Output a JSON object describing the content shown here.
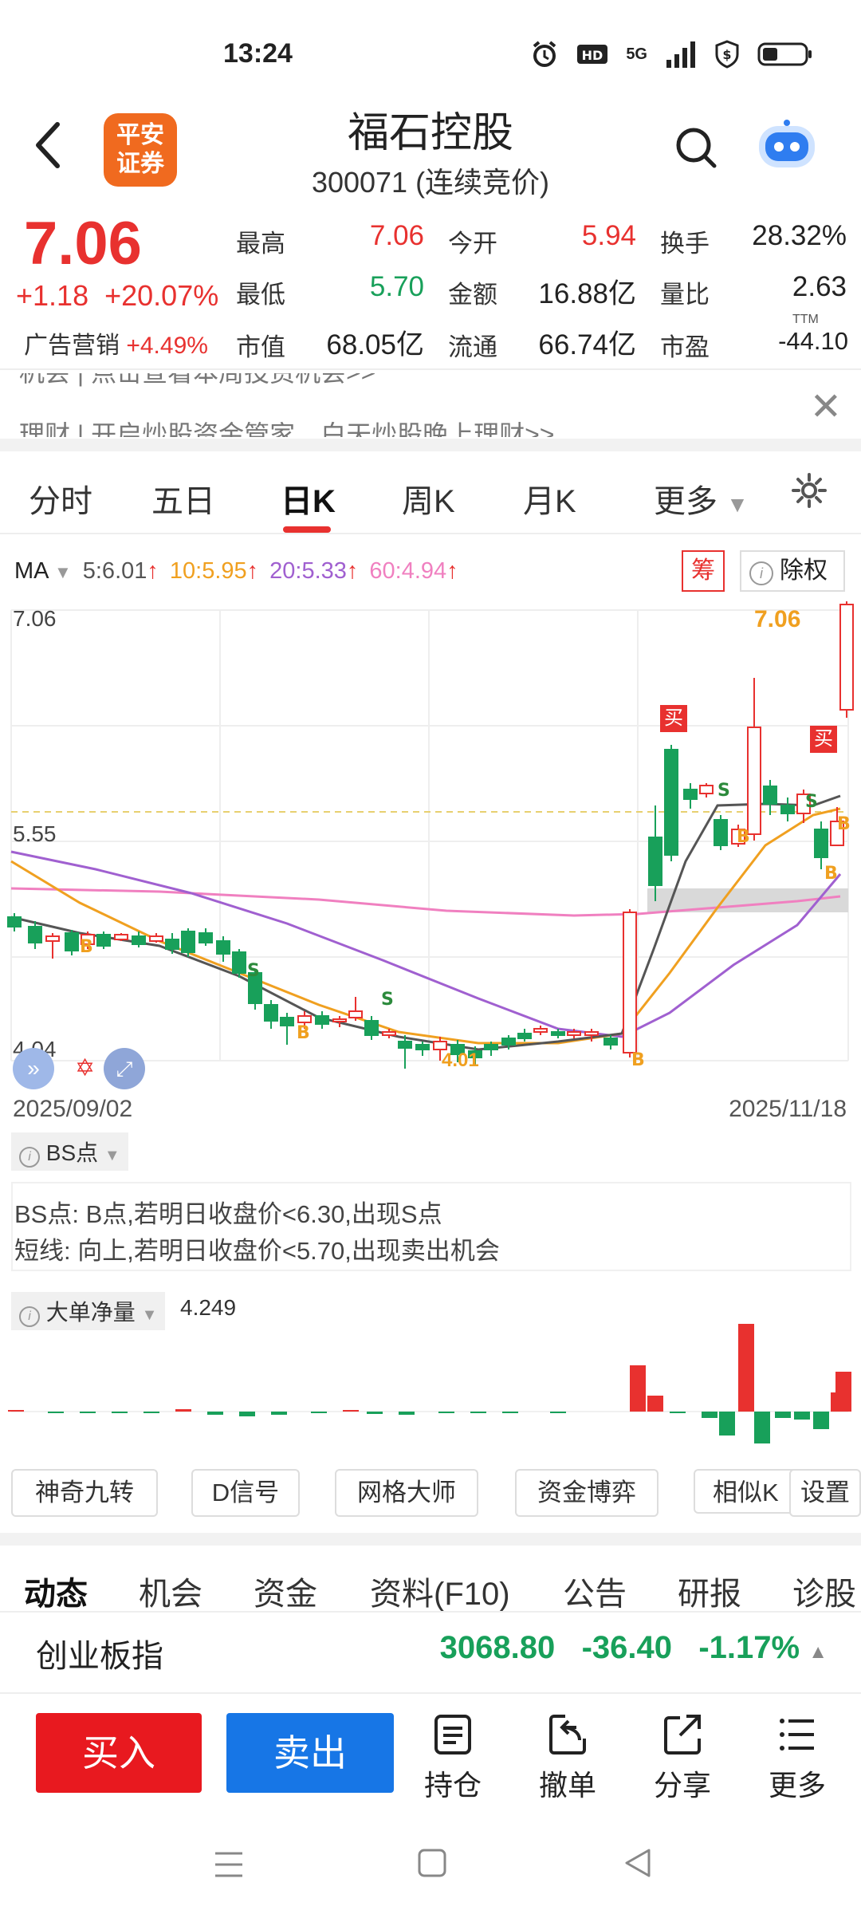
{
  "status_bar": {
    "time": "13:24",
    "network": "5G"
  },
  "header": {
    "logo_line1": "平安",
    "logo_line2": "证券",
    "stock_name": "福石控股",
    "stock_code": "300071 (连续竞价)"
  },
  "quote": {
    "price": "7.06",
    "change": "+1.18",
    "change_pct": "+20.07%",
    "ad_label": "广告营销",
    "ad_pct": "+4.49%",
    "stats": [
      {
        "label": "最高",
        "value": "7.06",
        "color": "#e8312f"
      },
      {
        "label": "今开",
        "value": "5.94",
        "color": "#e8312f"
      },
      {
        "label": "换手",
        "value": "28.32%",
        "color": "#222"
      },
      {
        "label": "最低",
        "value": "5.70",
        "color": "#18a05a"
      },
      {
        "label": "金额",
        "value": "16.88亿",
        "color": "#222"
      },
      {
        "label": "量比",
        "value": "2.63",
        "color": "#222"
      },
      {
        "label": "市值",
        "value": "68.05亿",
        "color": "#222"
      },
      {
        "label": "流通",
        "value": "66.74亿",
        "color": "#222"
      },
      {
        "label": "市盈",
        "value": "-44.10",
        "color": "#222"
      }
    ],
    "pe_superscript": "TTM"
  },
  "banner": {
    "line1": "机会  |  点击查看本周投资机会>>",
    "line2": "理财  |  开启炒股资金管家，白天炒股晚上理财>>"
  },
  "kline_tabs": [
    "分时",
    "五日",
    "日K",
    "周K",
    "月K",
    "更多"
  ],
  "ma_row": {
    "label": "MA",
    "ma5": "5:6.01",
    "ma10": "10:5.95",
    "ma20": "20:5.33",
    "ma60": "60:4.94",
    "colors": {
      "ma5": "#555555",
      "ma10": "#f0a020",
      "ma20": "#a060d0",
      "ma60": "#f080c0"
    }
  },
  "chart_buttons": {
    "chou": "筹",
    "chuquan": "除权"
  },
  "chart_data": {
    "type": "candlestick",
    "price_axis_labels": [
      "7.06",
      "5.55",
      "4.04"
    ],
    "ylim": [
      4.04,
      7.06
    ],
    "start_date": "2025/09/02",
    "end_date": "2025/11/18",
    "annotations": {
      "max_label": "7.06",
      "min_label": "4.01",
      "buy_tag": "买",
      "signal_b": "B",
      "signal_s": "S"
    },
    "colors": {
      "up": "#e8312f",
      "down": "#18a05a"
    }
  },
  "bs_section": {
    "selector": "BS点",
    "line1": "BS点: B点,若明日收盘价<6.30,出现S点",
    "line2": "短线: 向上,若明日收盘价<5.70,出现卖出机会"
  },
  "flow_section": {
    "selector": "大单净量",
    "value": "4.249"
  },
  "tools": [
    "神奇九转",
    "D信号",
    "网格大师",
    "资金博弈",
    "相似K",
    "设置"
  ],
  "bottom_tabs": [
    "动态",
    "机会",
    "资金",
    "资料(F10)",
    "公告",
    "研报",
    "诊股"
  ],
  "index_bar": {
    "name": "创业板指",
    "value": "3068.80",
    "change": "-36.40",
    "pct": "-1.17%"
  },
  "actions": {
    "buy": "买入",
    "sell": "卖出",
    "holdings": "持仓",
    "cancel": "撤单",
    "share": "分享",
    "more": "更多"
  }
}
